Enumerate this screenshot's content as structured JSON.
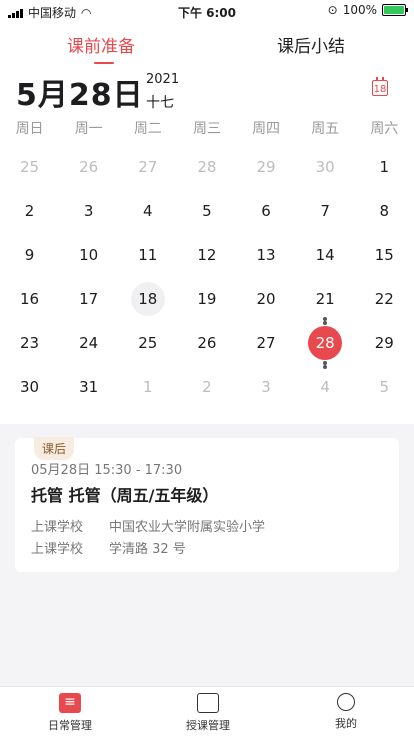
{
  "status": {
    "carrier": "中国移动",
    "time": "下午 6:00",
    "battery": "100%"
  },
  "tabs": {
    "active": "课前准备",
    "inactive": "课后小结"
  },
  "header": {
    "date": "5月28日",
    "year": "2021",
    "lunar": "十七",
    "today_icon": "18"
  },
  "weekdays": [
    "周日",
    "周一",
    "周二",
    "周三",
    "周四",
    "周五",
    "周六"
  ],
  "calendar": {
    "weeks": [
      [
        {
          "d": "25",
          "o": true
        },
        {
          "d": "26",
          "o": true
        },
        {
          "d": "27",
          "o": true
        },
        {
          "d": "28",
          "o": true
        },
        {
          "d": "29",
          "o": true
        },
        {
          "d": "30",
          "o": true
        },
        {
          "d": "1"
        }
      ],
      [
        {
          "d": "2"
        },
        {
          "d": "3"
        },
        {
          "d": "4"
        },
        {
          "d": "5"
        },
        {
          "d": "6"
        },
        {
          "d": "7"
        },
        {
          "d": "8"
        }
      ],
      [
        {
          "d": "9"
        },
        {
          "d": "10"
        },
        {
          "d": "11"
        },
        {
          "d": "12"
        },
        {
          "d": "13"
        },
        {
          "d": "14"
        },
        {
          "d": "15"
        }
      ],
      [
        {
          "d": "16"
        },
        {
          "d": "17"
        },
        {
          "d": "18",
          "today": true
        },
        {
          "d": "19"
        },
        {
          "d": "20"
        },
        {
          "d": "21",
          "dot": "below"
        },
        {
          "d": "22"
        }
      ],
      [
        {
          "d": "23"
        },
        {
          "d": "24"
        },
        {
          "d": "25"
        },
        {
          "d": "26"
        },
        {
          "d": "27"
        },
        {
          "d": "28",
          "selected": true,
          "dot": "both"
        },
        {
          "d": "29"
        }
      ],
      [
        {
          "d": "30"
        },
        {
          "d": "31"
        },
        {
          "d": "1",
          "o": true
        },
        {
          "d": "2",
          "o": true
        },
        {
          "d": "3",
          "o": true
        },
        {
          "d": "4",
          "o": true,
          "dot": "above"
        },
        {
          "d": "5",
          "o": true
        }
      ]
    ]
  },
  "course": {
    "tag": "课后",
    "time": "05月28日 15:30 - 17:30",
    "title": "托管 托管（周五/五年级）",
    "rows": [
      {
        "label": "上课学校",
        "value": "中国农业大学附属实验小学"
      },
      {
        "label": "上课学校",
        "value": "学清路 32 号"
      }
    ]
  },
  "tabbar": {
    "items": [
      "日常管理",
      "授课管理",
      "我的"
    ]
  },
  "colors": {
    "accent": "#e8494f"
  }
}
